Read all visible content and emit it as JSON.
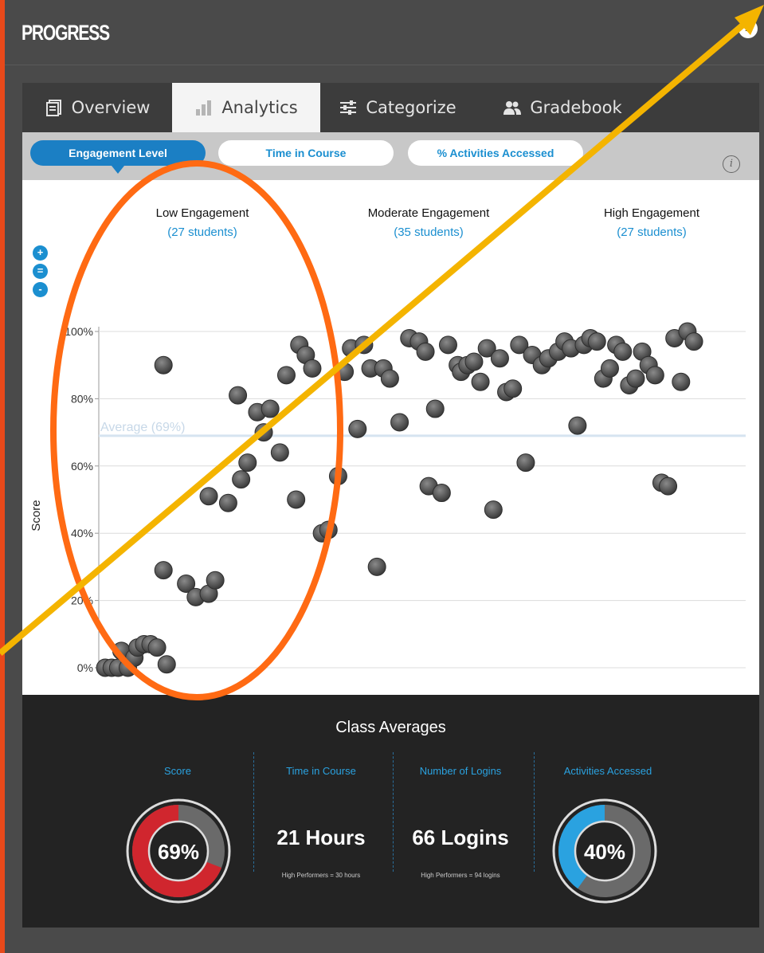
{
  "header": {
    "title": "PROGRESS",
    "collapse_icon": "»"
  },
  "tabs": [
    {
      "label": "Overview",
      "icon": "document-icon",
      "active": false
    },
    {
      "label": "Analytics",
      "icon": "bar-chart-icon",
      "active": true
    },
    {
      "label": "Categorize",
      "icon": "sliders-icon",
      "active": false
    },
    {
      "label": "Gradebook",
      "icon": "users-icon",
      "active": false
    }
  ],
  "subtabs": [
    {
      "label": "Engagement Level",
      "active": true
    },
    {
      "label": "Time in Course",
      "active": false
    },
    {
      "label": "% Activities Accessed",
      "active": false
    }
  ],
  "zoom": {
    "in": "+",
    "reset": "=",
    "out": "-"
  },
  "chart_data": {
    "type": "scatter",
    "ylabel": "Score",
    "y_ticks": [
      "0%",
      "20%",
      "40%",
      "60%",
      "80%",
      "100%"
    ],
    "ylim": [
      0,
      100
    ],
    "average": {
      "label": "Average (69%)",
      "value": 69
    },
    "groups": [
      {
        "name": "Low Engagement",
        "count_label": "(27 students)"
      },
      {
        "name": "Moderate Engagement",
        "count_label": "(35 students)"
      },
      {
        "name": "High Engagement",
        "count_label": "(27 students)"
      }
    ],
    "x_range": [
      0,
      100
    ],
    "points": [
      [
        1,
        0
      ],
      [
        2,
        0
      ],
      [
        3,
        0
      ],
      [
        3.5,
        5
      ],
      [
        4.5,
        0
      ],
      [
        5.5,
        3
      ],
      [
        6,
        6
      ],
      [
        7,
        7
      ],
      [
        8,
        7
      ],
      [
        9,
        6
      ],
      [
        10.5,
        1
      ],
      [
        10,
        90
      ],
      [
        10,
        29
      ],
      [
        13.5,
        25
      ],
      [
        15,
        21
      ],
      [
        17,
        22
      ],
      [
        18,
        26
      ],
      [
        17,
        51
      ],
      [
        20,
        49
      ],
      [
        21.5,
        81
      ],
      [
        22,
        56
      ],
      [
        23,
        61
      ],
      [
        24.5,
        76
      ],
      [
        25.5,
        70
      ],
      [
        26.5,
        77
      ],
      [
        28,
        64
      ],
      [
        29,
        87
      ],
      [
        30.5,
        50
      ],
      [
        31,
        96
      ],
      [
        32,
        93
      ],
      [
        33,
        89
      ],
      [
        34.5,
        40
      ],
      [
        35.5,
        41
      ],
      [
        37,
        57
      ],
      [
        38,
        88
      ],
      [
        39,
        95
      ],
      [
        40,
        71
      ],
      [
        41,
        96
      ],
      [
        42,
        89
      ],
      [
        43,
        30
      ],
      [
        44,
        89
      ],
      [
        45,
        86
      ],
      [
        46.5,
        73
      ],
      [
        48,
        98
      ],
      [
        49.5,
        97
      ],
      [
        50.5,
        94
      ],
      [
        51,
        54
      ],
      [
        52,
        77
      ],
      [
        53,
        52
      ],
      [
        54,
        96
      ],
      [
        55.5,
        90
      ],
      [
        56,
        88
      ],
      [
        57,
        90
      ],
      [
        58,
        91
      ],
      [
        59,
        85
      ],
      [
        60,
        95
      ],
      [
        61,
        47
      ],
      [
        62,
        92
      ],
      [
        63,
        82
      ],
      [
        64,
        83
      ],
      [
        65,
        96
      ],
      [
        66,
        61
      ],
      [
        67,
        93
      ],
      [
        68.5,
        90
      ],
      [
        69.5,
        92
      ],
      [
        71,
        94
      ],
      [
        72,
        97
      ],
      [
        73,
        95
      ],
      [
        74,
        72
      ],
      [
        75,
        96
      ],
      [
        76,
        98
      ],
      [
        77,
        97
      ],
      [
        78,
        86
      ],
      [
        79,
        89
      ],
      [
        80,
        96
      ],
      [
        81,
        94
      ],
      [
        82,
        84
      ],
      [
        83,
        86
      ],
      [
        84,
        94
      ],
      [
        85,
        90
      ],
      [
        86,
        87
      ],
      [
        87,
        55
      ],
      [
        88,
        54
      ],
      [
        89,
        98
      ],
      [
        90,
        85
      ],
      [
        91,
        100
      ],
      [
        92,
        97
      ]
    ]
  },
  "class_averages": {
    "title": "Class Averages",
    "stats": [
      {
        "label": "Score",
        "value": "69%",
        "fraction": 0.69,
        "color": "#d0262e"
      },
      {
        "label": "Time in Course",
        "value": "21 Hours",
        "note": "High Performers = 30 hours"
      },
      {
        "label": "Number of Logins",
        "value": "66 Logins",
        "note": "High Performers = 94 logins"
      },
      {
        "label": "Activities Accessed",
        "value": "40%",
        "fraction": 0.4,
        "color": "#2aa2e0"
      }
    ]
  },
  "overlay": {
    "ellipse_color": "#ff6a13",
    "arrow_color": "#f4b400"
  }
}
